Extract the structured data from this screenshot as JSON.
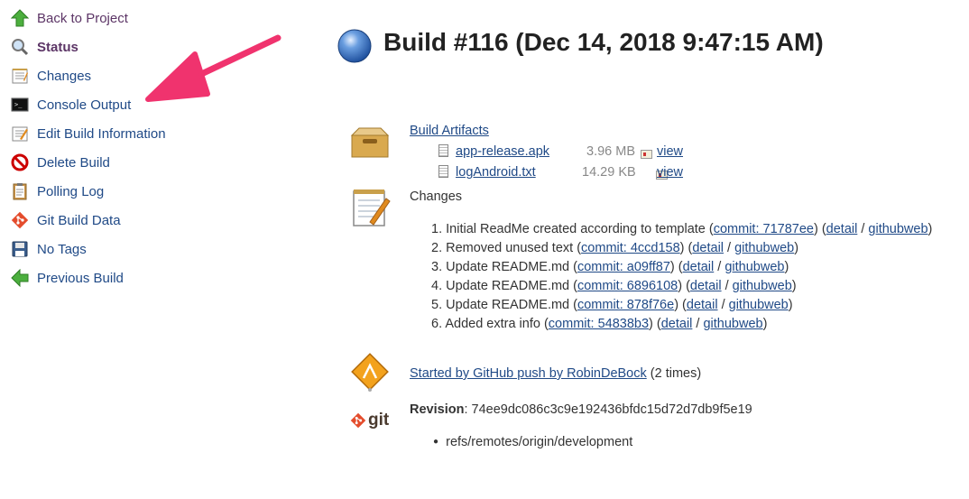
{
  "sidebar": {
    "items": [
      {
        "label": "Back to Project",
        "icon": "up-arrow-icon"
      },
      {
        "label": "Status",
        "icon": "magnifier-icon"
      },
      {
        "label": "Changes",
        "icon": "notepad-icon"
      },
      {
        "label": "Console Output",
        "icon": "terminal-icon"
      },
      {
        "label": "Edit Build Information",
        "icon": "edit-notepad-icon"
      },
      {
        "label": "Delete Build",
        "icon": "no-entry-icon"
      },
      {
        "label": "Polling Log",
        "icon": "clipboard-icon"
      },
      {
        "label": "Git Build Data",
        "icon": "git-icon"
      },
      {
        "label": "No Tags",
        "icon": "floppy-icon"
      },
      {
        "label": "Previous Build",
        "icon": "left-arrow-icon"
      }
    ]
  },
  "build": {
    "title": "Build #116 (Dec 14, 2018 9:47:15 AM)",
    "status_color": "#3465a4"
  },
  "artifacts": {
    "heading": "Build Artifacts",
    "files": [
      {
        "name": "app-release.apk",
        "size": "3.96 MB",
        "view": "view"
      },
      {
        "name": "logAndroid.txt",
        "size": "14.29 KB",
        "view": "view"
      }
    ]
  },
  "changes": {
    "heading": "Changes",
    "items": [
      {
        "num": "1.",
        "msg": "Initial ReadMe created according to template",
        "commit": "commit: 71787ee",
        "detail": "detail",
        "web": "githubweb"
      },
      {
        "num": "2.",
        "msg": "Removed unused text",
        "commit": "commit: 4ccd158",
        "detail": "detail",
        "web": "githubweb"
      },
      {
        "num": "3.",
        "msg": "Update README.md",
        "commit": "commit: a09ff87",
        "detail": "detail",
        "web": "githubweb"
      },
      {
        "num": "4.",
        "msg": "Update README.md",
        "commit": "commit: 6896108",
        "detail": "detail",
        "web": "githubweb"
      },
      {
        "num": "5.",
        "msg": "Update README.md",
        "commit": "commit: 878f76e",
        "detail": "detail",
        "web": "githubweb"
      },
      {
        "num": "6.",
        "msg": "Added extra info",
        "commit": "commit: 54838b3",
        "detail": "detail",
        "web": "githubweb"
      }
    ]
  },
  "cause": {
    "link": "Started by GitHub push by RobinDeBock",
    "suffix": "(2 times)"
  },
  "revision": {
    "label": "Revision",
    "hash": "74ee9dc086c3c9e192436bfdc15d72d7db9f5e19",
    "git_logo": "git",
    "branches": [
      "refs/remotes/origin/development"
    ]
  },
  "colors": {
    "link": "#204a87",
    "annotation_arrow": "#f0336e"
  }
}
